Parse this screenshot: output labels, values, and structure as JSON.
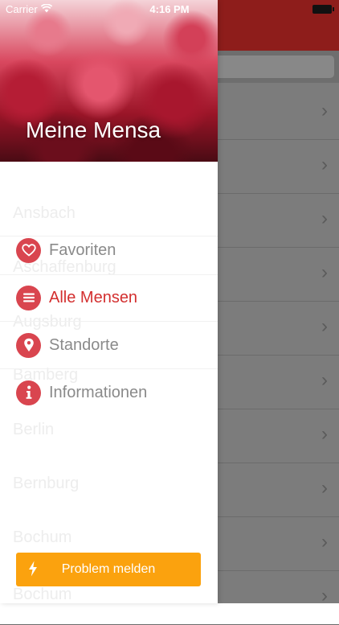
{
  "status_bar": {
    "carrier": "Carrier",
    "time": "4:16 PM"
  },
  "drawer": {
    "title": "Meine Mensa",
    "menu": [
      {
        "label": "Favoriten",
        "icon": "heart-icon",
        "active": false
      },
      {
        "label": "Alle Mensen",
        "icon": "list-icon",
        "active": true
      },
      {
        "label": "Standorte",
        "icon": "location-pin-icon",
        "active": false
      },
      {
        "label": "Informationen",
        "icon": "info-icon",
        "active": false
      }
    ],
    "problem_button": {
      "label": "Problem melden",
      "icon": "lightning-icon"
    },
    "background_list_labels": [
      "Ansbach",
      "Aschaffenburg",
      "Augsburg",
      "Bamberg",
      "Berlin",
      "Bernburg",
      "Bochum",
      "Bochum"
    ]
  },
  "colors": {
    "accent": "#d32f2f",
    "icon_circle": "#d9454f",
    "button": "#fba20e",
    "navbar": "#8e1d1b"
  }
}
